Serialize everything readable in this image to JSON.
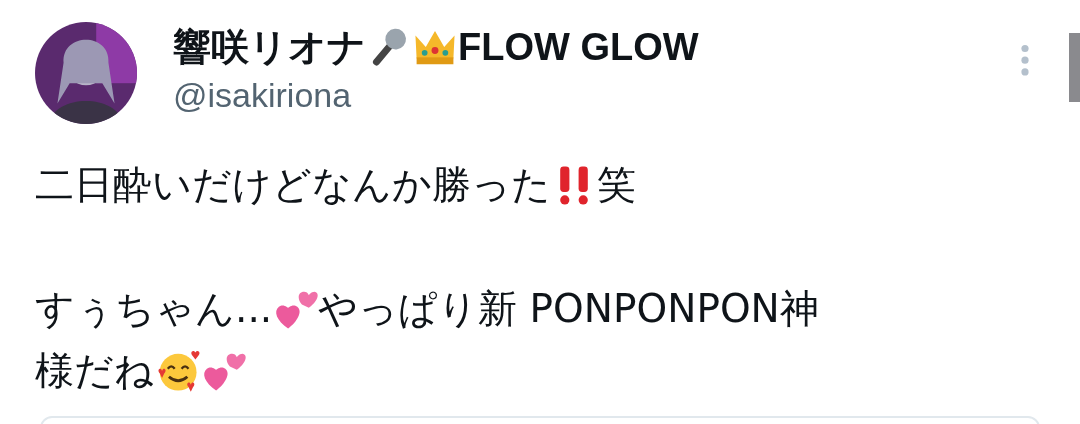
{
  "author": {
    "name": [
      {
        "kind": "text",
        "text": "響咲リオナ"
      },
      {
        "kind": "mic"
      },
      {
        "kind": "crown"
      },
      {
        "kind": "text",
        "text": "FLOW GLOW"
      }
    ],
    "handle": "@isakiriona"
  },
  "paragraphs": [
    [
      [
        {
          "kind": "text",
          "text": "二日酔いだけどなんか勝った"
        },
        {
          "kind": "exclaim"
        },
        {
          "kind": "text",
          "text": "笑"
        }
      ]
    ],
    [
      [
        {
          "kind": "text",
          "text": "すぅちゃん..."
        },
        {
          "kind": "hearts"
        },
        {
          "kind": "text",
          "text": "やっぱり新 PONPONPON神"
        }
      ],
      [
        {
          "kind": "text",
          "text": "様だね"
        },
        {
          "kind": "smile"
        },
        {
          "kind": "hearts"
        }
      ]
    ]
  ]
}
